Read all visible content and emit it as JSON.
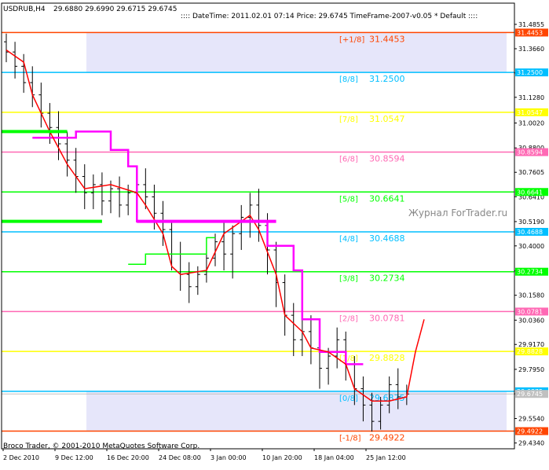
{
  "header": {
    "symbol": "USDRUB,H4",
    "ohlc": "29.6880 29.6990 29.6715 29.6745",
    "status": ":::: DateTime: 2011.02.01 07:14    Price: 29.6745    TimeFrame-2007-v0.05    *  Default  ::::"
  },
  "watermark": "Журнал ForTrader.ru",
  "copyright": "Broco Trader, © 2001-2010 MetaQuotes Software Corp.",
  "colors": {
    "background": "#ffffff",
    "zone": "#e6e6fa",
    "candle": "#000000",
    "red_line": "#ff0000",
    "magenta_line": "#ff00ff",
    "green_line": "#00ff00",
    "axis": "#000000"
  },
  "chart_data": {
    "type": "candlestick",
    "ylim": [
      29.4057,
      31.5047
    ],
    "y_ticks": [
      "31.4855",
      "31.3660",
      "31.2475",
      "31.1280",
      "31.0020",
      "30.8800",
      "30.7605",
      "30.6410",
      "30.5190",
      "30.4000",
      "30.2775",
      "30.1580",
      "30.0360",
      "29.9170",
      "29.7950",
      "29.6750",
      "29.5540",
      "29.4340"
    ],
    "x_ticks": [
      "2 Dec 2010",
      "9 Dec 12:00",
      "16 Dec 20:00",
      "24 Dec 08:00",
      "3 Jan 00:00",
      "10 Jan 20:00",
      "18 Jan 04:00",
      "25 Jan 12:00"
    ],
    "murrey_levels": [
      {
        "label": "[+1/8]",
        "value": 31.4453,
        "tag": "31.4453",
        "color": "#ff4500"
      },
      {
        "label": "[8/8]",
        "value": 31.25,
        "tag": "31.2500",
        "color": "#00bfff"
      },
      {
        "label": "[7/8]",
        "value": 31.0547,
        "tag": "31.0547",
        "color": "#ffff00"
      },
      {
        "label": "[6/8]",
        "value": 30.8594,
        "tag": "30.8594",
        "color": "#ff69b4"
      },
      {
        "label": "[5/8]",
        "value": 30.6641,
        "tag": "30.6641",
        "color": "#00ff00"
      },
      {
        "label": "[4/8]",
        "value": 30.4688,
        "tag": "30.4688",
        "color": "#00bfff"
      },
      {
        "label": "[3/8]",
        "value": 30.2734,
        "tag": "30.2734",
        "color": "#00ff00"
      },
      {
        "label": "[2/8]",
        "value": 30.0781,
        "tag": "30.0781",
        "color": "#ff69b4"
      },
      {
        "label": "[1/8]",
        "value": 29.8828,
        "tag": "29.8828",
        "color": "#ffff00"
      },
      {
        "label": "[0/8]",
        "value": 29.6875,
        "tag": "29.6875",
        "color": "#00bfff"
      },
      {
        "label": "[-1/8]",
        "value": 29.4922,
        "tag": "29.4922",
        "color": "#ff4500"
      }
    ],
    "current_price": {
      "value": 29.6745,
      "tag": "29.6745",
      "color": "#c0c0c0"
    },
    "candles": [
      {
        "x": 0,
        "o": 31.4,
        "h": 31.44,
        "c": 31.35,
        "l": 31.3
      },
      {
        "x": 1,
        "o": 31.35,
        "h": 31.4,
        "c": 31.28,
        "l": 31.22
      },
      {
        "x": 2,
        "o": 31.28,
        "h": 31.34,
        "c": 31.2,
        "l": 31.15
      },
      {
        "x": 3,
        "o": 31.2,
        "h": 31.28,
        "c": 31.14,
        "l": 31.08
      },
      {
        "x": 4,
        "o": 31.14,
        "h": 31.2,
        "c": 31.05,
        "l": 30.98
      },
      {
        "x": 5,
        "o": 31.05,
        "h": 31.1,
        "c": 30.98,
        "l": 30.9
      },
      {
        "x": 6,
        "o": 30.98,
        "h": 31.06,
        "c": 30.9,
        "l": 30.82
      },
      {
        "x": 7,
        "o": 30.9,
        "h": 30.96,
        "c": 30.82,
        "l": 30.74
      },
      {
        "x": 8,
        "o": 30.82,
        "h": 30.88,
        "c": 30.74,
        "l": 30.66
      },
      {
        "x": 9,
        "o": 30.74,
        "h": 30.8,
        "c": 30.66,
        "l": 30.58
      },
      {
        "x": 10,
        "o": 30.66,
        "h": 30.75,
        "c": 30.7,
        "l": 30.58
      },
      {
        "x": 11,
        "o": 30.7,
        "h": 30.76,
        "c": 30.62,
        "l": 30.55
      },
      {
        "x": 12,
        "o": 30.62,
        "h": 30.72,
        "c": 30.68,
        "l": 30.56
      },
      {
        "x": 13,
        "o": 30.68,
        "h": 30.74,
        "c": 30.6,
        "l": 30.54
      },
      {
        "x": 14,
        "o": 30.6,
        "h": 30.7,
        "c": 30.66,
        "l": 30.55
      },
      {
        "x": 15,
        "o": 30.66,
        "h": 30.76,
        "c": 30.7,
        "l": 30.6
      },
      {
        "x": 16,
        "o": 30.7,
        "h": 30.78,
        "c": 30.64,
        "l": 30.58
      },
      {
        "x": 17,
        "o": 30.64,
        "h": 30.7,
        "c": 30.56,
        "l": 30.48
      },
      {
        "x": 18,
        "o": 30.56,
        "h": 30.62,
        "c": 30.48,
        "l": 30.4
      },
      {
        "x": 19,
        "o": 30.48,
        "h": 30.52,
        "c": 30.36,
        "l": 30.28
      },
      {
        "x": 20,
        "o": 30.36,
        "h": 30.42,
        "c": 30.26,
        "l": 30.18
      },
      {
        "x": 21,
        "o": 30.26,
        "h": 30.32,
        "c": 30.2,
        "l": 30.12
      },
      {
        "x": 22,
        "o": 30.2,
        "h": 30.3,
        "c": 30.26,
        "l": 30.16
      },
      {
        "x": 23,
        "o": 30.26,
        "h": 30.38,
        "c": 30.34,
        "l": 30.22
      },
      {
        "x": 24,
        "o": 30.34,
        "h": 30.46,
        "c": 30.42,
        "l": 30.3
      },
      {
        "x": 25,
        "o": 30.42,
        "h": 30.52,
        "c": 30.36,
        "l": 30.28
      },
      {
        "x": 26,
        "o": 30.36,
        "h": 30.5,
        "c": 30.46,
        "l": 30.24
      },
      {
        "x": 27,
        "o": 30.46,
        "h": 30.6,
        "c": 30.54,
        "l": 30.38
      },
      {
        "x": 28,
        "o": 30.54,
        "h": 30.66,
        "c": 30.6,
        "l": 30.44
      },
      {
        "x": 29,
        "o": 30.6,
        "h": 30.68,
        "c": 30.5,
        "l": 30.42
      },
      {
        "x": 30,
        "o": 30.5,
        "h": 30.56,
        "c": 30.38,
        "l": 30.26
      },
      {
        "x": 31,
        "o": 30.38,
        "h": 30.42,
        "c": 30.22,
        "l": 30.1
      },
      {
        "x": 32,
        "o": 30.22,
        "h": 30.26,
        "c": 30.06,
        "l": 29.96
      },
      {
        "x": 33,
        "o": 30.06,
        "h": 30.12,
        "c": 29.94,
        "l": 29.86
      },
      {
        "x": 34,
        "o": 29.94,
        "h": 30.04,
        "c": 29.98,
        "l": 29.86
      },
      {
        "x": 35,
        "o": 29.98,
        "h": 30.06,
        "c": 29.9,
        "l": 29.82
      },
      {
        "x": 36,
        "o": 29.9,
        "h": 29.96,
        "c": 29.8,
        "l": 29.7
      },
      {
        "x": 37,
        "o": 29.8,
        "h": 29.9,
        "c": 29.86,
        "l": 29.72
      },
      {
        "x": 38,
        "o": 29.86,
        "h": 30.0,
        "c": 29.94,
        "l": 29.8
      },
      {
        "x": 39,
        "o": 29.94,
        "h": 29.98,
        "c": 29.82,
        "l": 29.74
      },
      {
        "x": 40,
        "o": 29.82,
        "h": 29.86,
        "c": 29.7,
        "l": 29.62
      },
      {
        "x": 41,
        "o": 29.7,
        "h": 29.76,
        "c": 29.62,
        "l": 29.54
      },
      {
        "x": 42,
        "o": 29.62,
        "h": 29.68,
        "c": 29.54,
        "l": 29.49
      },
      {
        "x": 43,
        "o": 29.54,
        "h": 29.66,
        "c": 29.62,
        "l": 29.5
      },
      {
        "x": 44,
        "o": 29.62,
        "h": 29.76,
        "c": 29.72,
        "l": 29.58
      },
      {
        "x": 45,
        "o": 29.72,
        "h": 29.8,
        "c": 29.66,
        "l": 29.6
      },
      {
        "x": 46,
        "o": 29.66,
        "h": 29.72,
        "c": 29.674,
        "l": 29.62
      }
    ],
    "red_line": [
      {
        "x": 0,
        "y": 31.36
      },
      {
        "x": 2,
        "y": 31.3
      },
      {
        "x": 3,
        "y": 31.14
      },
      {
        "x": 5,
        "y": 30.96
      },
      {
        "x": 7,
        "y": 30.8
      },
      {
        "x": 9,
        "y": 30.68
      },
      {
        "x": 12,
        "y": 30.7
      },
      {
        "x": 15,
        "y": 30.66
      },
      {
        "x": 16,
        "y": 30.6
      },
      {
        "x": 18,
        "y": 30.46
      },
      {
        "x": 19,
        "y": 30.3
      },
      {
        "x": 20,
        "y": 30.26
      },
      {
        "x": 23,
        "y": 30.28
      },
      {
        "x": 25,
        "y": 30.46
      },
      {
        "x": 28,
        "y": 30.55
      },
      {
        "x": 29,
        "y": 30.48
      },
      {
        "x": 31,
        "y": 30.26
      },
      {
        "x": 32,
        "y": 30.06
      },
      {
        "x": 34,
        "y": 29.98
      },
      {
        "x": 35,
        "y": 29.9
      },
      {
        "x": 37,
        "y": 29.88
      },
      {
        "x": 39,
        "y": 29.82
      },
      {
        "x": 40,
        "y": 29.7
      },
      {
        "x": 42,
        "y": 29.64
      },
      {
        "x": 44,
        "y": 29.64
      },
      {
        "x": 46,
        "y": 29.66
      },
      {
        "x": 47,
        "y": 29.88
      },
      {
        "x": 48,
        "y": 30.04
      }
    ],
    "magenta_line": [
      {
        "x": 3,
        "y": 30.93
      },
      {
        "x": 8,
        "y": 30.93
      },
      {
        "x": 8,
        "y": 30.96
      },
      {
        "x": 12,
        "y": 30.96
      },
      {
        "x": 12,
        "y": 30.87
      },
      {
        "x": 14,
        "y": 30.87
      },
      {
        "x": 14,
        "y": 30.79
      },
      {
        "x": 15,
        "y": 30.79
      },
      {
        "x": 15,
        "y": 30.52
      },
      {
        "x": 30,
        "y": 30.52
      },
      {
        "x": 30,
        "y": 30.4
      },
      {
        "x": 33,
        "y": 30.4
      },
      {
        "x": 33,
        "y": 30.28
      },
      {
        "x": 34,
        "y": 30.28
      },
      {
        "x": 34,
        "y": 30.04
      },
      {
        "x": 36,
        "y": 30.04
      },
      {
        "x": 36,
        "y": 29.88
      },
      {
        "x": 39,
        "y": 29.88
      },
      {
        "x": 39,
        "y": 29.82
      },
      {
        "x": 41,
        "y": 29.82
      }
    ],
    "green_line": [
      {
        "x": 14,
        "y": 30.31
      },
      {
        "x": 16,
        "y": 30.31
      },
      {
        "x": 16,
        "y": 30.36
      },
      {
        "x": 23,
        "y": 30.36
      },
      {
        "x": 23,
        "y": 30.44
      },
      {
        "x": 24,
        "y": 30.44
      }
    ],
    "tripled_lines": [
      {
        "x_end": 7,
        "y": 30.96,
        "color": "#00ff00"
      },
      {
        "x_end": 11,
        "y": 30.52,
        "color": "#00ff00"
      },
      {
        "x_start": 15,
        "x_end": 31,
        "y": 30.52,
        "color": "#ff00ff"
      }
    ]
  }
}
